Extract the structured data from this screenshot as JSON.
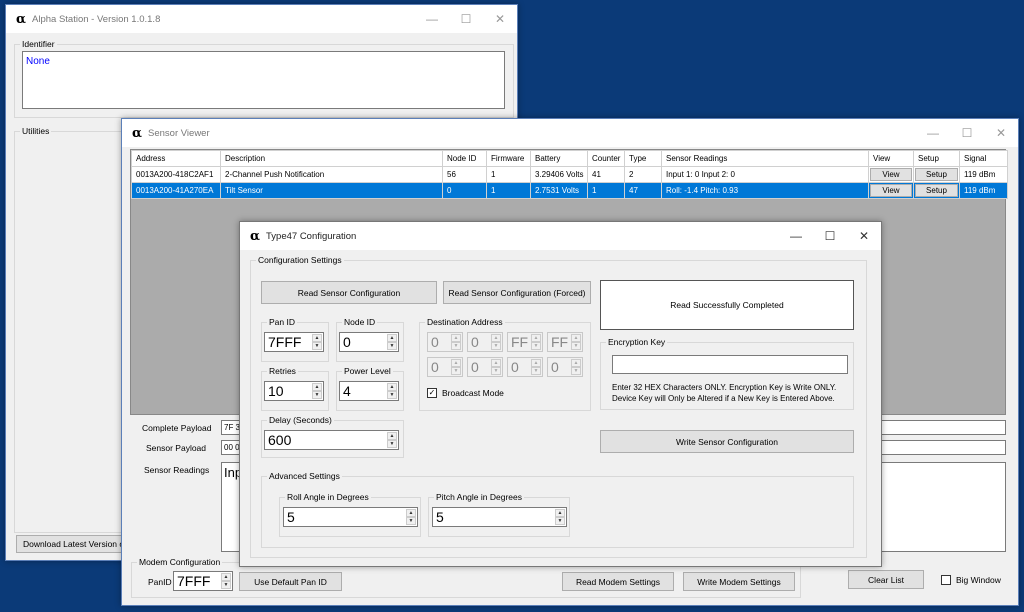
{
  "main_window": {
    "title": "Alpha Station - Version 1.0.1.8",
    "identifier_label": "Identifier",
    "identifier_value": "None",
    "utilities_label": "Utilities",
    "download_button": "Download Latest Version of"
  },
  "sensor_viewer": {
    "title": "Sensor Viewer",
    "columns": [
      "Address",
      "Description",
      "Node ID",
      "Firmware",
      "Battery",
      "Counter",
      "Type",
      "Sensor Readings",
      "View",
      "Setup",
      "Signal"
    ],
    "rows": [
      {
        "address": "0013A200-418C2AF1",
        "description": "2-Channel Push Notification",
        "node_id": "56",
        "firmware": "1",
        "battery": "3.29406 Volts",
        "counter": "41",
        "type": "2",
        "readings": "Input 1: 0  Input 2: 0",
        "view": "View",
        "setup": "Setup",
        "signal": "119 dBm"
      },
      {
        "address": "0013A200-41A270EA",
        "description": "Tilt Sensor",
        "node_id": "0",
        "firmware": "1",
        "battery": "2.7531 Volts",
        "counter": "1",
        "type": "47",
        "readings": "Roll: -1.4 Pitch: 0.93",
        "view": "View",
        "setup": "Setup",
        "signal": "119 dBm"
      }
    ],
    "complete_payload_label": "Complete Payload",
    "complete_payload_value": "7F 3",
    "sensor_payload_label": "Sensor Payload",
    "sensor_payload_value": "00 0",
    "sensor_readings_label": "Sensor Readings",
    "sensor_readings_value": "Inp",
    "modem_config_label": "Modem Configuration",
    "panid_label": "PanID",
    "panid_value": "7FFF",
    "use_default_button": "Use Default Pan ID",
    "read_modem_button": "Read Modem Settings",
    "write_modem_button": "Write Modem Settings",
    "clear_list_button": "Clear List",
    "big_window_label": "Big Window"
  },
  "config_dialog": {
    "title": "Type47 Configuration",
    "config_settings_label": "Configuration Settings",
    "read_config_button": "Read Sensor Configuration",
    "read_forced_button": "Read Sensor Configuration (Forced)",
    "status_text": "Read Successfully Completed",
    "pan_id_label": "Pan ID",
    "pan_id_value": "7FFF",
    "node_id_label": "Node ID",
    "node_id_value": "0",
    "retries_label": "Retries",
    "retries_value": "10",
    "power_level_label": "Power Level",
    "power_level_value": "4",
    "delay_label": "Delay (Seconds)",
    "delay_value": "600",
    "dest_address_label": "Destination Address",
    "dest_address": [
      "0",
      "0",
      "FF",
      "FF",
      "0",
      "0",
      "0",
      "0"
    ],
    "broadcast_label": "Broadcast Mode",
    "broadcast_checked": true,
    "encryption_label": "Encryption Key",
    "encryption_value": "",
    "encryption_note_1": "Enter 32 HEX Characters ONLY.  Encryption Key is Write ONLY.",
    "encryption_note_2": "Device Key will Only be Altered if a New Key is Entered Above.",
    "write_config_button": "Write Sensor Configuration",
    "advanced_label": "Advanced Settings",
    "roll_label": "Roll Angle in Degrees",
    "roll_value": "5",
    "pitch_label": "Pitch Angle in Degrees",
    "pitch_value": "5"
  },
  "colors": {
    "desktop": "#0b3a78",
    "selection": "#0078d7",
    "identifier_text": "#0000ff"
  }
}
